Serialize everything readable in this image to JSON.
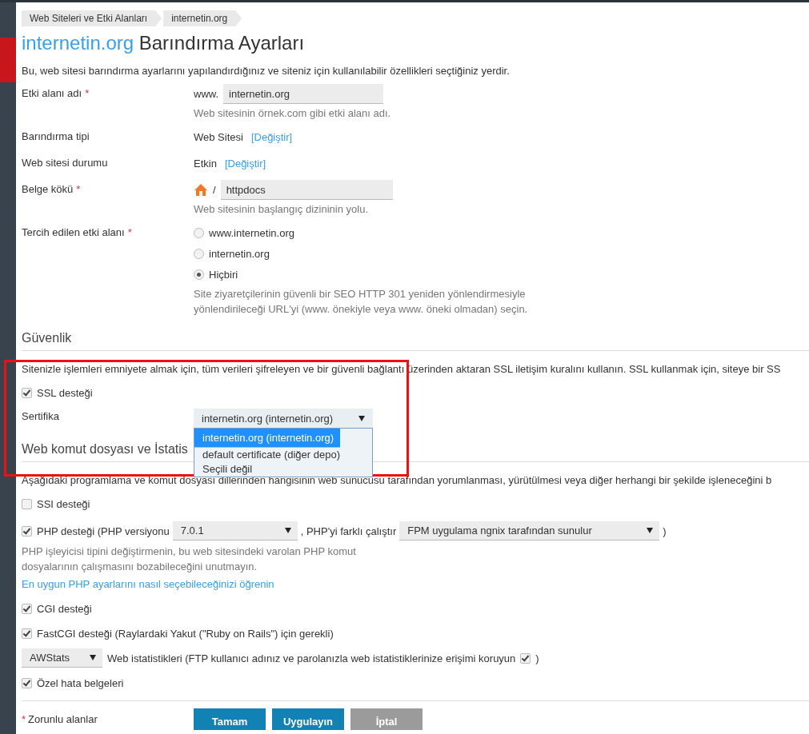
{
  "breadcrumb": [
    {
      "label": "Web Siteleri ve Etki Alanları"
    },
    {
      "label": "internetin.org"
    }
  ],
  "title": {
    "domain": "internetin.org",
    "text": "Barındırma Ayarları"
  },
  "required_mark": "*",
  "intro": "Bu, web sitesi barındırma ayarlarını yapılandırdığınız ve siteniz için kullanılabilir özellikleri seçtiğiniz yerdir.",
  "fields": [
    {
      "kind": "input",
      "label": "Etki alanı adı",
      "required": true,
      "prefix": "www.",
      "value": "internetin.org",
      "hint": "Web sitesinin örnek.com gibi etki alanı adı."
    },
    {
      "kind": "text",
      "label": "Barındırma tipi",
      "required": false,
      "value": "Web Sitesi",
      "link": "[Değiştir]"
    },
    {
      "kind": "text",
      "label": "Web sitesi durumu",
      "required": false,
      "value": "Etkin",
      "link": "[Değiştir]"
    },
    {
      "kind": "path",
      "label": "Belge kökü",
      "required": true,
      "prefix": "/",
      "value": "httpdocs",
      "hint": "Web sitesinin başlangıç dizininin yolu."
    },
    {
      "kind": "radio",
      "label": "Tercih edilen etki alanı",
      "required": true,
      "options": [
        {
          "label": "www.internetin.org",
          "selected": false
        },
        {
          "label": "internetin.org",
          "selected": false
        },
        {
          "label": "Hiçbiri",
          "selected": true
        }
      ],
      "hint": "Site ziyaretçilerinin güvenli bir SEO HTTP 301 yeniden yönlendirmesiyle yönlendirileceği URL'yi (www. önekiyle veya www. öneki olmadan) seçin."
    }
  ],
  "security": {
    "heading": "Güvenlik",
    "description": "Sitenizle işlemleri emniyete almak için, tüm verileri şifreleyen ve bir güvenli bağlantı üzerinden aktaran SSL iletişim kuralını kullanın. SSL kullanmak için, siteye bir SS",
    "ssl": {
      "label": "SSL desteği",
      "checked": true
    },
    "certificate": {
      "label": "Sertifika",
      "value": "internetin.org (internetin.org)",
      "options": [
        {
          "label": "internetin.org (internetin.org)",
          "selected": true
        },
        {
          "label": "default certificate (diğer depo)",
          "selected": false
        },
        {
          "label": "Seçili değil",
          "selected": false
        }
      ]
    }
  },
  "scripting": {
    "heading": "Web komut dosyası ve İstatis",
    "description": "Aşağıdaki programlama ve komut dosyası dillerinden hangisinin web sunucusu tarafından yorumlanması, yürütülmesi veya diğer herhangi bir şekilde işleneceğini b",
    "ssi": {
      "label": "SSI desteği",
      "checked": false
    },
    "php": {
      "label": "PHP desteği (PHP versiyonu",
      "checked": true,
      "version": "7.0.1",
      "run_as_label": ", PHP'yi farklı çalıştır",
      "handler": "FPM uygulama ngnix tarafından sunulur",
      "close": ")",
      "hint": "PHP işleyicisi tipini değiştirmenin, bu web sitesindeki varolan PHP komut dosyalarının çalışmasını bozabileceğini unutmayın.",
      "link": "En uygun PHP ayarlarını nasıl seçebileceğinizi öğrenin"
    },
    "cgi": {
      "label": "CGI desteği",
      "checked": true
    },
    "fastcgi": {
      "label": "FastCGI desteği (Raylardaki Yakut (\"Ruby on Rails\") için gerekli)",
      "checked": true
    },
    "stats": {
      "value": "AWStats",
      "label": "Web istatistikleri (FTP kullanıcı adınız ve parolanızla web istatistiklerinize erişimi koruyun",
      "protect_checked": true,
      "close": ")"
    },
    "errors": {
      "label": "Özel hata belgeleri",
      "checked": true
    }
  },
  "footer": {
    "required_note": "Zorunlu alanlar",
    "buttons": [
      {
        "label": "Tamam",
        "kind": "primary"
      },
      {
        "label": "Uygulayın",
        "kind": "primary"
      },
      {
        "label": "İptal",
        "kind": "secondary"
      }
    ]
  }
}
